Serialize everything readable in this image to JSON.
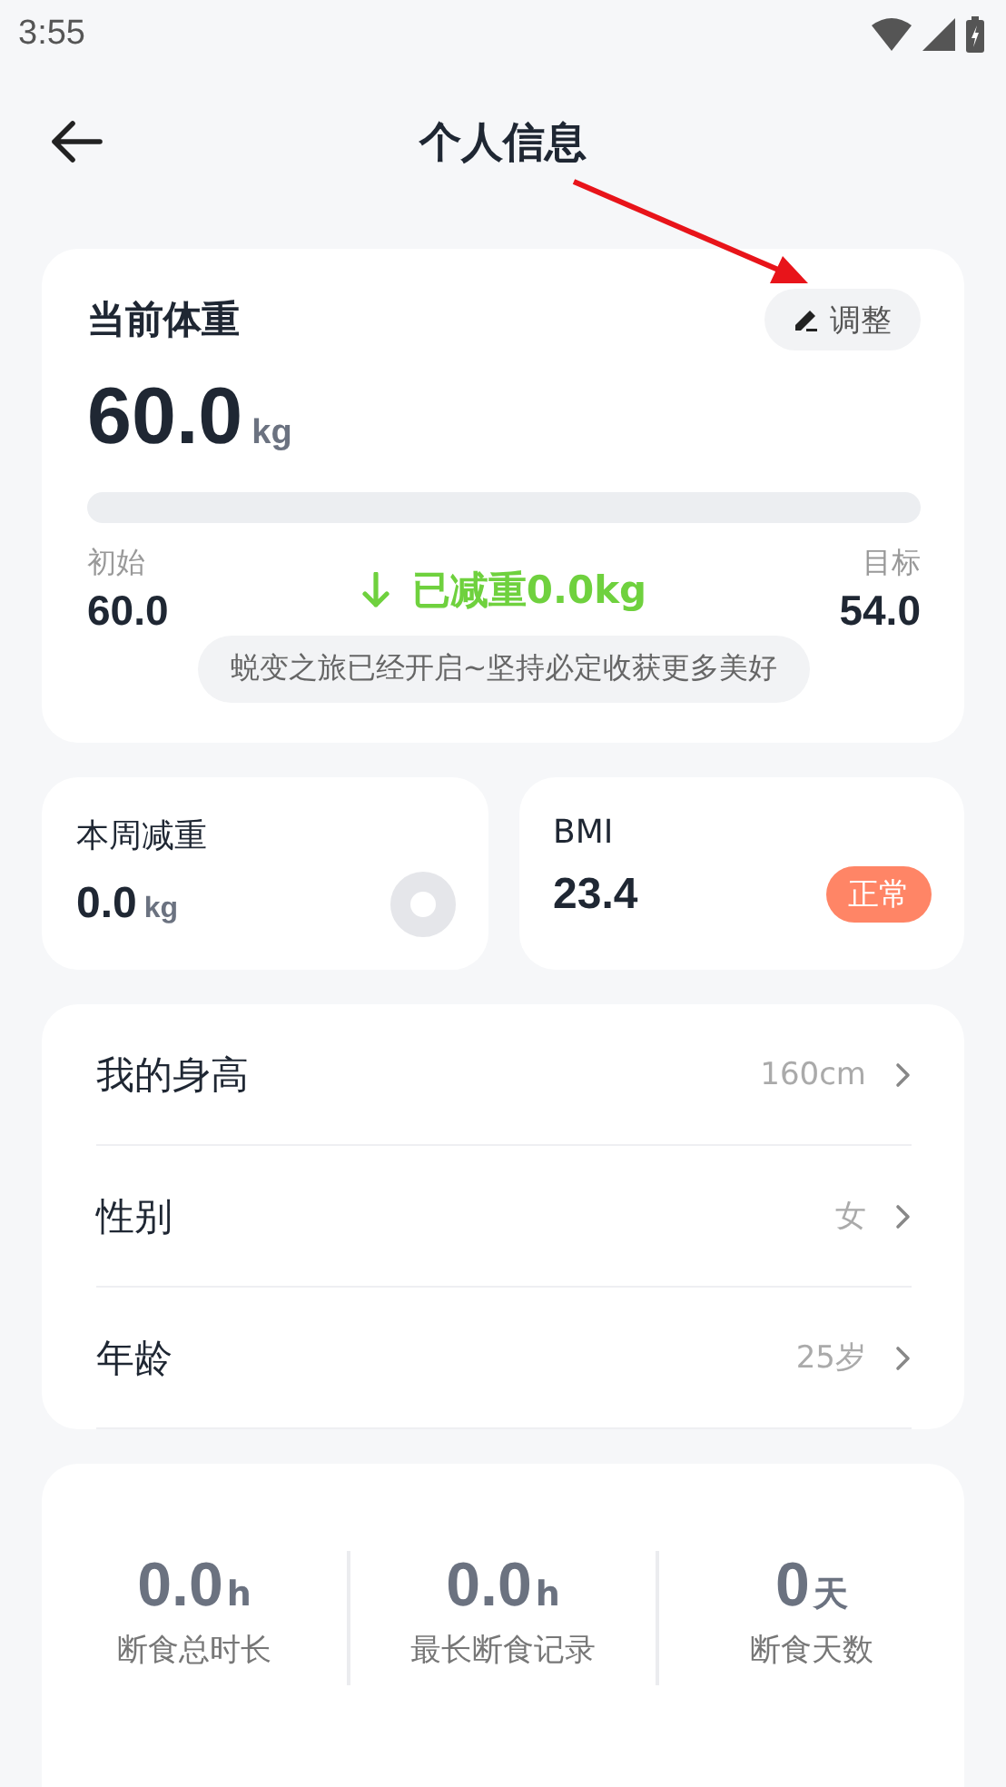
{
  "status_bar": {
    "time": "3:55"
  },
  "header": {
    "title": "个人信息"
  },
  "weight_card": {
    "title": "当前体重",
    "adjust_button": "调整",
    "value": "60.0",
    "unit": "kg",
    "progress": {
      "level": 0
    },
    "start_label": "初始",
    "start_value": "60.0",
    "lost_text": "已减重0.0kg",
    "target_label": "目标",
    "target_value": "54.0",
    "message": "蜕变之旅已经开启~坚持必定收获更多美好"
  },
  "week_card": {
    "title": "本周减重",
    "value": "0.0",
    "unit": "kg"
  },
  "bmi_card": {
    "title": "BMI",
    "value": "23.4",
    "tag": "正常",
    "color": "#ff8566"
  },
  "info_rows": [
    {
      "label": "我的身高",
      "value": "160cm"
    },
    {
      "label": "性别",
      "value": "女"
    },
    {
      "label": "年龄",
      "value": "25岁"
    }
  ],
  "fasting_stats": [
    {
      "value": "0.0",
      "unit": "h",
      "label": "断食总时长"
    },
    {
      "value": "0.0",
      "unit": "h",
      "label": "最长断食记录"
    },
    {
      "value": "0",
      "unit": "天",
      "label": "断食天数"
    }
  ]
}
